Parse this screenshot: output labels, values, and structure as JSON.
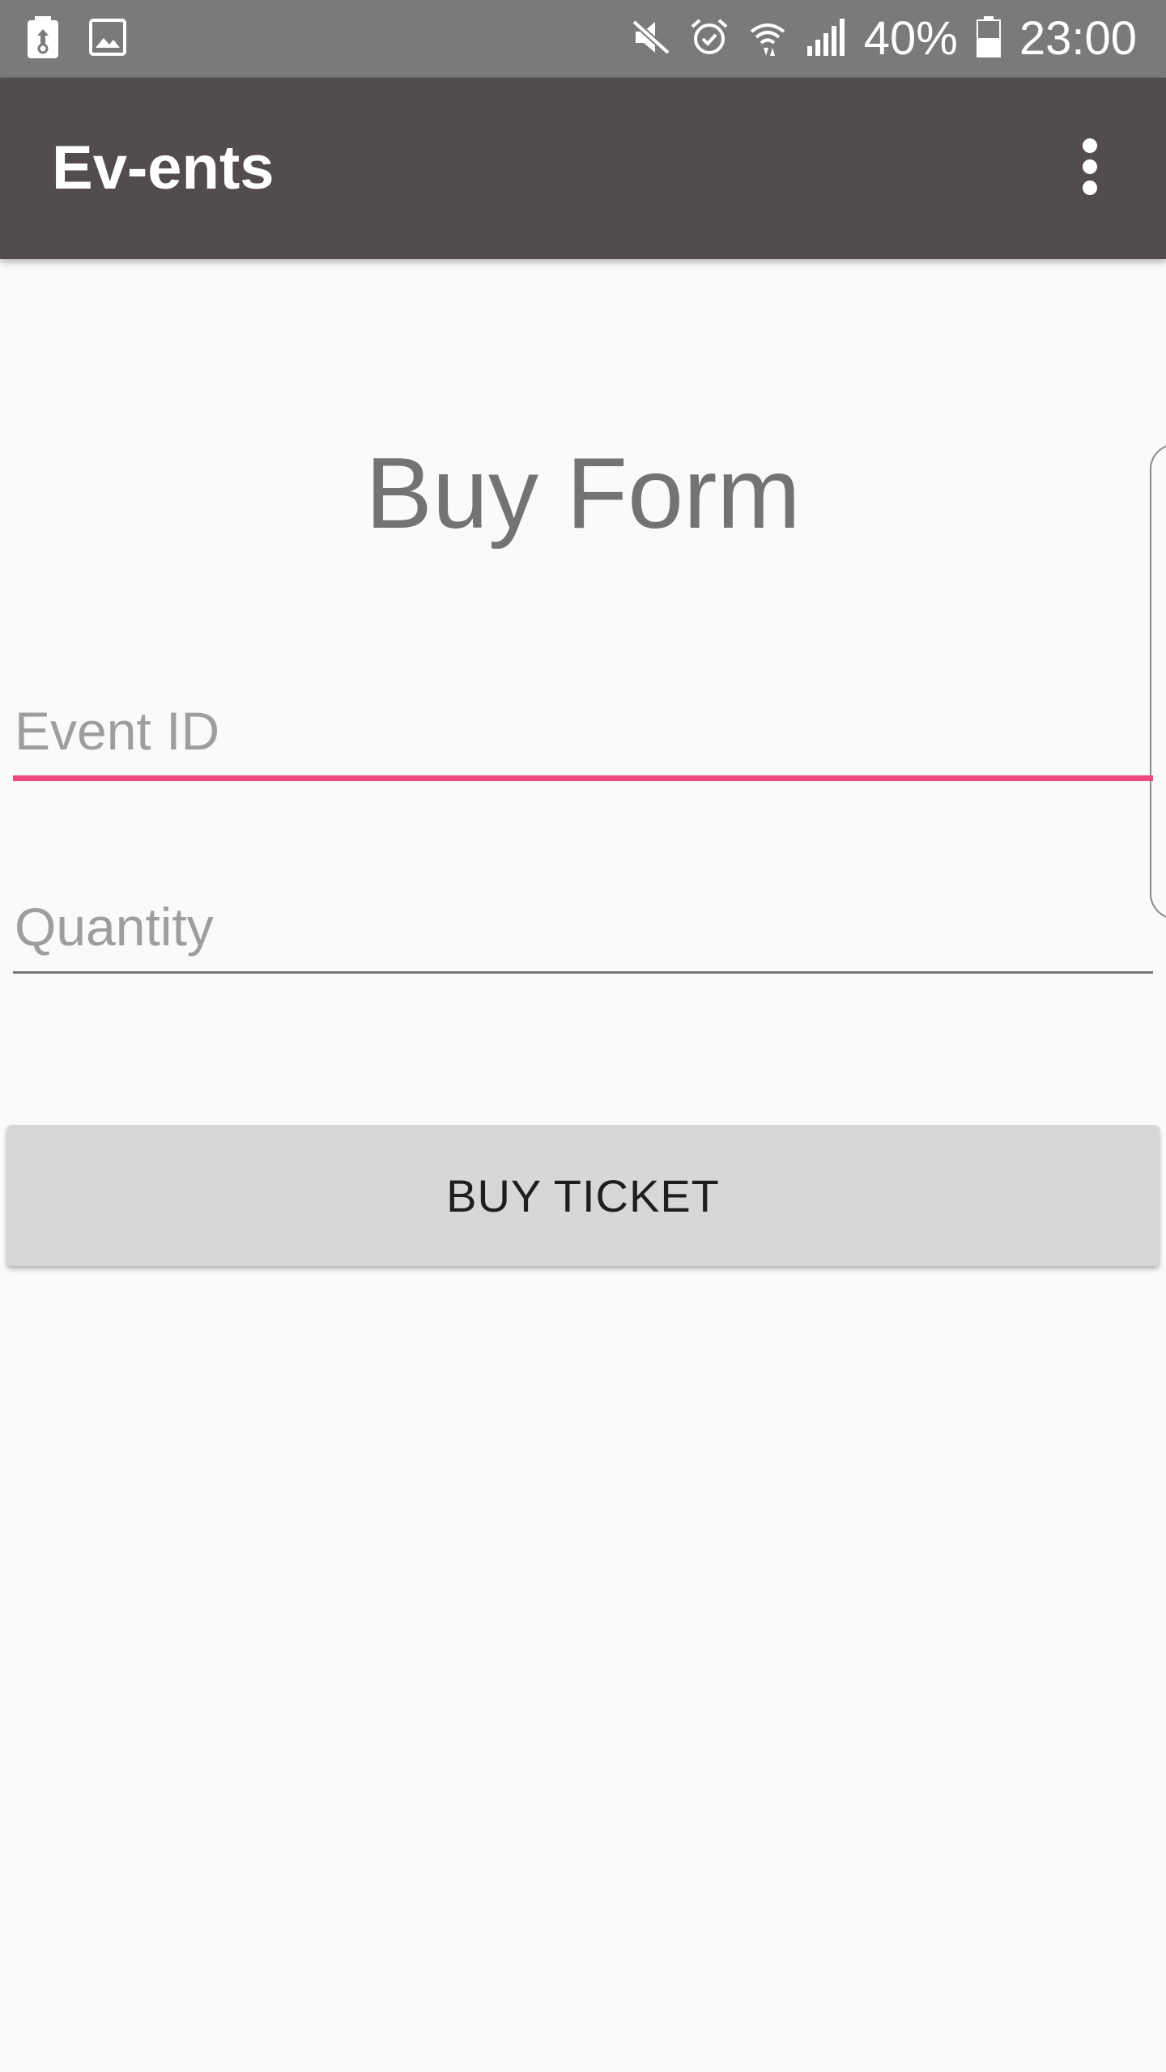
{
  "status_bar": {
    "icons_left": [
      "battery-saver-icon",
      "image-icon"
    ],
    "icons_right": [
      "mute-icon",
      "alarm-icon",
      "wifi-icon",
      "signal-icon",
      "battery-icon"
    ],
    "battery_percent": "40%",
    "time": "23:00",
    "background": "#7a7a7a"
  },
  "app_bar": {
    "title": "Ev-ents",
    "menu_icon": "more-vert-icon",
    "background": "#524c4c"
  },
  "form": {
    "title": "Buy Form",
    "event_id": {
      "placeholder": "Event ID",
      "value": "",
      "focused": true,
      "accent": "#ef4a7f"
    },
    "quantity": {
      "placeholder": "Quantity",
      "value": ""
    },
    "buy_button_label": "BUY TICKET"
  }
}
